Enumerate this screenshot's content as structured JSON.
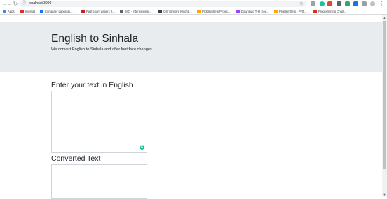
{
  "browser": {
    "url": "localhost:3000",
    "nav": {
      "back": "←",
      "forward": "→",
      "reload": "↻"
    },
    "bookmarks": [
      {
        "label": "Apps",
        "color": "#4285f4"
      },
      {
        "label": "Internet",
        "color": "#d93025"
      },
      {
        "label": "Computer Laborato...",
        "color": "#1a73e8"
      },
      {
        "label": "Past exam papers 2...",
        "color": "#c5221f"
      },
      {
        "label": "IMC - International...",
        "color": "#5f6368"
      },
      {
        "label": "Ost Vampire Knight...",
        "color": "#3c4043"
      },
      {
        "label": "ProblemSets/Projec...",
        "color": "#f9ab00"
      },
      {
        "label": "Download THz Kee...",
        "color": "#a142f4"
      },
      {
        "label": "ProblemSets - Pyth...",
        "color": "#f9ab00"
      },
      {
        "label": "Programming Chall...",
        "color": "#d93025"
      }
    ]
  },
  "hero": {
    "title": "English to Sinhala",
    "subtitle": "We convert English to Sinhala and offer font face changes"
  },
  "input_section": {
    "label": "Enter your text in English",
    "value": ""
  },
  "output_section": {
    "label": "Converted Text",
    "value": ""
  },
  "grammarly_icon": "G"
}
